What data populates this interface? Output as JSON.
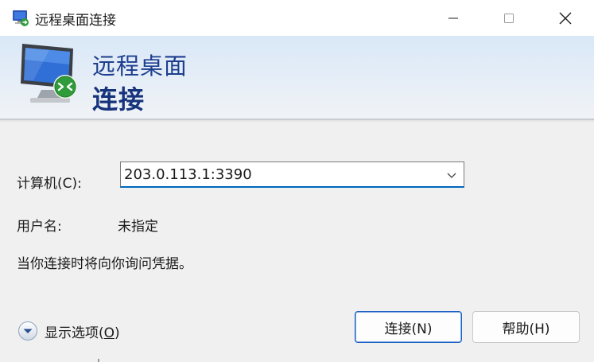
{
  "window": {
    "title": "远程桌面连接",
    "controls": {
      "minimize": "minimize",
      "maximize": "maximize",
      "close": "close"
    }
  },
  "banner": {
    "line1": "远程桌面",
    "line2": "连接",
    "icon": "remote-desktop-monitor-icon"
  },
  "form": {
    "computer_label": "计算机(C):",
    "computer_value": "203.0.113.1:3390",
    "username_label": "用户名:",
    "username_value": "未指定",
    "info_text": "当你连接时将向你询问凭据。"
  },
  "footer": {
    "show_options_prefix": "显示选项(",
    "show_options_key": "O",
    "show_options_suffix": ")",
    "connect_button": "连接(N)",
    "help_button": "帮助(H)"
  },
  "colors": {
    "banner_title": "#1d3e8e",
    "accent": "#0067c0",
    "window_bg": "#f0f0f0"
  }
}
